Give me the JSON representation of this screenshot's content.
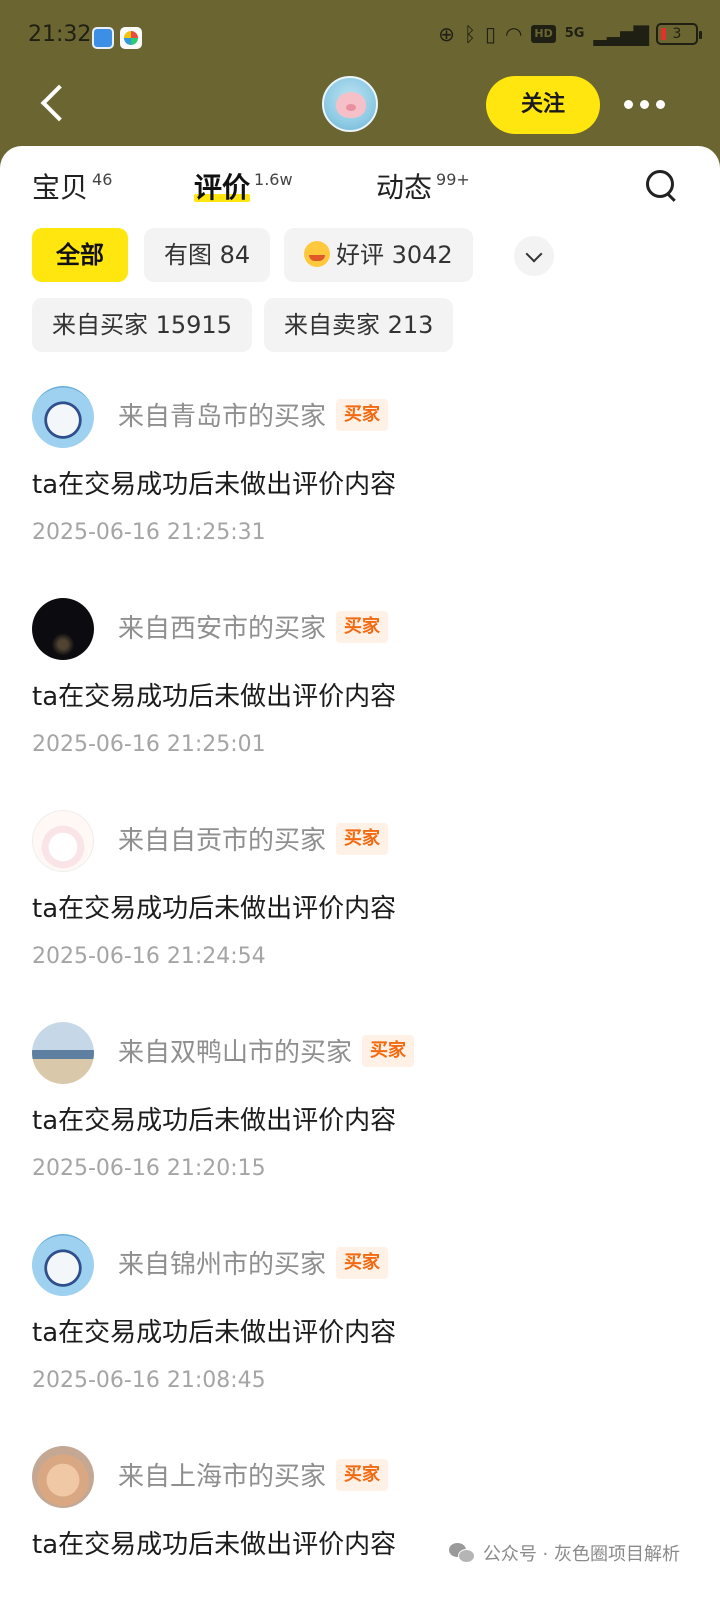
{
  "status_bar": {
    "time": "21:32",
    "network": "5G",
    "hd": "HD",
    "battery": "3"
  },
  "header": {
    "follow_label": "关注"
  },
  "tabs": [
    {
      "label": "宝贝",
      "count": "46"
    },
    {
      "label": "评价",
      "count": "1.6w"
    },
    {
      "label": "动态",
      "count": "99+"
    }
  ],
  "filters": {
    "all": "全部",
    "with_image": "有图 84",
    "good": "好评 3042",
    "from_buyer": "来自买家 15915",
    "from_seller": "来自卖家 213"
  },
  "reviews": [
    {
      "name": "来自青岛市的买家",
      "badge": "买家",
      "text": "ta在交易成功后未做出评价内容",
      "time": "2025-06-16 21:25:31"
    },
    {
      "name": "来自西安市的买家",
      "badge": "买家",
      "text": "ta在交易成功后未做出评价内容",
      "time": "2025-06-16 21:25:01"
    },
    {
      "name": "来自自贡市的买家",
      "badge": "买家",
      "text": "ta在交易成功后未做出评价内容",
      "time": "2025-06-16 21:24:54"
    },
    {
      "name": "来自双鸭山市的买家",
      "badge": "买家",
      "text": "ta在交易成功后未做出评价内容",
      "time": "2025-06-16 21:20:15"
    },
    {
      "name": "来自锦州市的买家",
      "badge": "买家",
      "text": "ta在交易成功后未做出评价内容",
      "time": "2025-06-16 21:08:45"
    },
    {
      "name": "来自上海市的买家",
      "badge": "买家",
      "text": "ta在交易成功后未做出评价内容",
      "time": ""
    }
  ],
  "watermark": "公众号 · 灰色圈项目解析",
  "colors": {
    "header_bg": "#6b6631",
    "accent_yellow": "#ffe60f",
    "badge_orange": "#f26a12"
  }
}
